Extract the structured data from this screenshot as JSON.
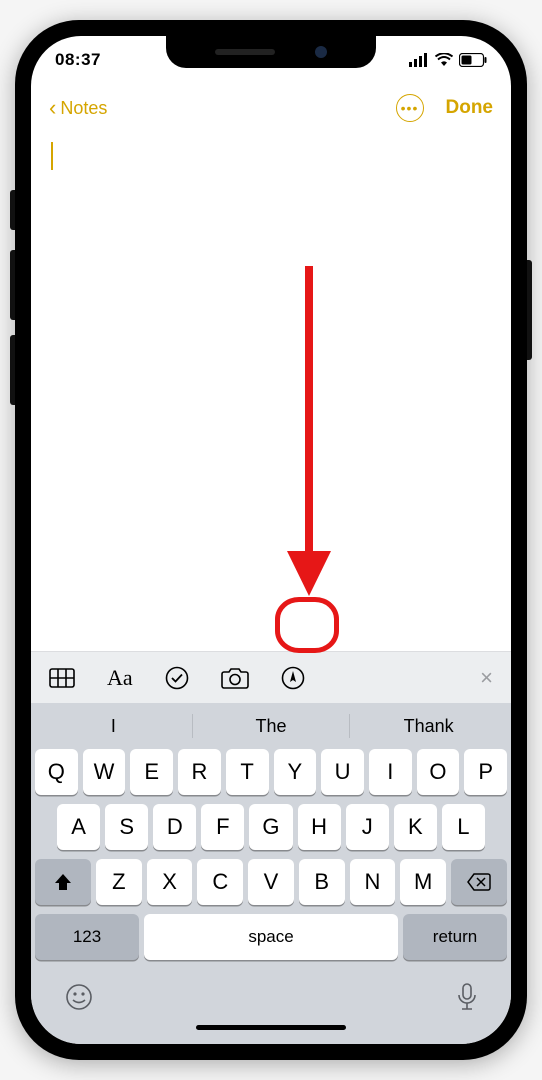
{
  "status": {
    "time": "08:37"
  },
  "nav": {
    "back": "Notes",
    "done": "Done"
  },
  "toolbar": {
    "table_icon": "table-icon",
    "text_icon": "Aa",
    "check_icon": "checkmark-circle-icon",
    "camera_icon": "camera-icon",
    "draw_icon": "pen-circle-icon",
    "close_icon": "×"
  },
  "suggestions": [
    "I",
    "The",
    "Thank"
  ],
  "keys": {
    "row1": [
      "Q",
      "W",
      "E",
      "R",
      "T",
      "Y",
      "U",
      "I",
      "O",
      "P"
    ],
    "row2": [
      "A",
      "S",
      "D",
      "F",
      "G",
      "H",
      "J",
      "K",
      "L"
    ],
    "row3": [
      "Z",
      "X",
      "C",
      "V",
      "B",
      "N",
      "M"
    ],
    "numbers": "123",
    "space": "space",
    "return": "return"
  }
}
